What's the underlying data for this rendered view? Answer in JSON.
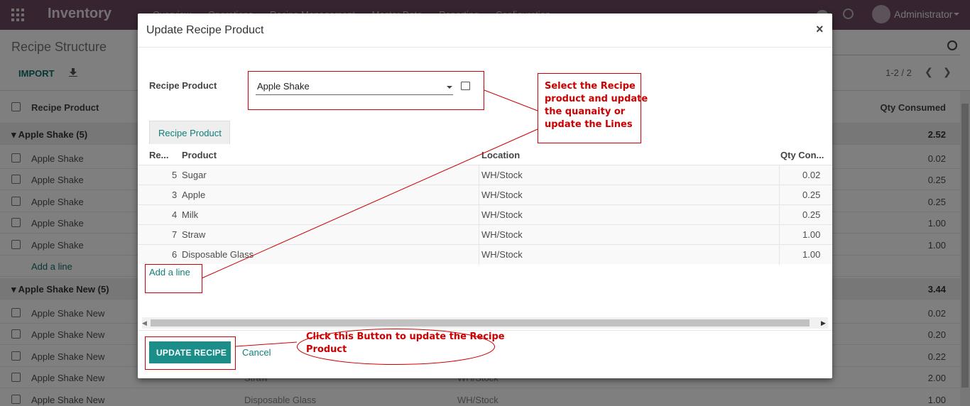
{
  "navbar": {
    "brand": "Inventory",
    "menus": [
      "Overview",
      "Operations",
      "Recipe Management",
      "Master Data",
      "Reporting",
      "Configuration"
    ],
    "user": "Administrator"
  },
  "control_panel": {
    "title": "Recipe Structure",
    "import_label": "IMPORT",
    "pager": "1-2 / 2"
  },
  "list": {
    "headers": {
      "recipe_product": "Recipe Product",
      "qty_consumed": "Qty Consumed"
    },
    "group1": {
      "name": "Apple Shake (5)",
      "total": "2.52"
    },
    "group1_rows": [
      {
        "name": "Apple Shake",
        "qty": "0.02"
      },
      {
        "name": "Apple Shake",
        "qty": "0.25"
      },
      {
        "name": "Apple Shake",
        "qty": "0.25"
      },
      {
        "name": "Apple Shake",
        "qty": "1.00"
      },
      {
        "name": "Apple Shake",
        "qty": "1.00"
      }
    ],
    "add_line": "Add a line",
    "group2": {
      "name": "Apple Shake New (5)",
      "total": "3.44"
    },
    "group2_rows": [
      {
        "name": "Apple Shake New",
        "qty": "0.02",
        "p": "",
        "l": ""
      },
      {
        "name": "Apple Shake New",
        "qty": "0.20",
        "p": "",
        "l": ""
      },
      {
        "name": "Apple Shake New",
        "qty": "0.22",
        "p": "",
        "l": ""
      },
      {
        "name": "Apple Shake New",
        "qty": "2.00",
        "p": "Straw",
        "l": "WH/Stock"
      },
      {
        "name": "Apple Shake New",
        "qty": "1.00",
        "p": "Disposable Glass",
        "l": "WH/Stock"
      }
    ]
  },
  "modal": {
    "title": "Update Recipe Product",
    "close": "×",
    "recipe_product_label": "Recipe Product",
    "recipe_product_value": "Apple Shake",
    "tab_label": "Recipe Product",
    "columns": {
      "seq": "Re...",
      "product": "Product",
      "location": "Location",
      "qty": "Qty Con..."
    },
    "lines": [
      {
        "seq": "5",
        "product": "Sugar",
        "location": "WH/Stock",
        "qty": "0.02"
      },
      {
        "seq": "3",
        "product": "Apple",
        "location": "WH/Stock",
        "qty": "0.25"
      },
      {
        "seq": "4",
        "product": "Milk",
        "location": "WH/Stock",
        "qty": "0.25"
      },
      {
        "seq": "7",
        "product": "Straw",
        "location": "WH/Stock",
        "qty": "1.00"
      },
      {
        "seq": "6",
        "product": "Disposable Glass",
        "location": "WH/Stock",
        "qty": "1.00"
      }
    ],
    "add_line": "Add a line",
    "update_button": "UPDATE RECIPE",
    "cancel_button": "Cancel"
  },
  "annotations": {
    "select_note": [
      "Select the Recipe",
      "product and update",
      "the quanaity or",
      "update the Lines"
    ],
    "button_note": [
      "Click this Button to update the Recipe",
      "Product"
    ],
    "color": "#cc0000"
  }
}
